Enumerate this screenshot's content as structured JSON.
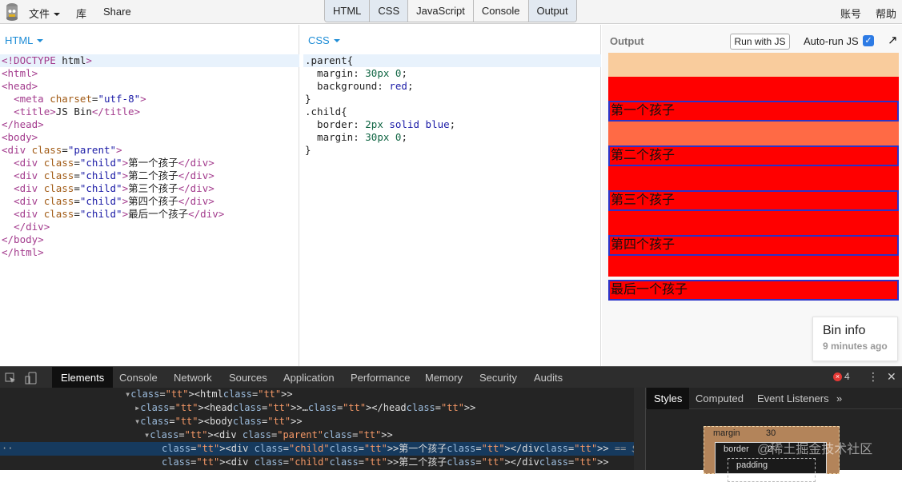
{
  "topbar": {
    "menu_file": "文件",
    "menu_library": "库",
    "menu_share": "Share",
    "tabs": [
      "HTML",
      "CSS",
      "JavaScript",
      "Console",
      "Output"
    ],
    "menu_account": "账号",
    "menu_help": "帮助"
  },
  "html_panel": {
    "title": "HTML",
    "lines": [
      "<!DOCTYPE html>",
      "<html>",
      "<head>",
      "  <meta charset=\"utf-8\">",
      "  <title>JS Bin</title>",
      "</head>",
      "<body>",
      "<div class=\"parent\">",
      "  <div class=\"child\">第一个孩子</div>",
      "  <div class=\"child\">第二个孩子</div>",
      "  <div class=\"child\">第三个孩子</div>",
      "  <div class=\"child\">第四个孩子</div>",
      "  <div class=\"child\">最后一个孩子</div>",
      "  </div>",
      "</body>",
      "</html>"
    ]
  },
  "css_panel": {
    "title": "CSS",
    "lines": [
      ".parent{",
      "  margin: 30px 0;",
      "  background: red;",
      "}",
      ".child{",
      "  border: 2px solid blue;",
      "  margin: 30px 0;",
      "}"
    ]
  },
  "output_panel": {
    "title": "Output",
    "run_button": "Run with JS",
    "autorun_label": "Auto-run JS",
    "autorun_checked": true,
    "children": [
      "第一个孩子",
      "第二个孩子",
      "第三个孩子",
      "第四个孩子",
      "最后一个孩子"
    ],
    "colors": {
      "margin_overlay": "#f9cc9d",
      "margin_highlight": "#ff6a45",
      "parent_bg": "#ff0000",
      "child_border": "#2b33c8"
    },
    "bin_info_title": "Bin info",
    "bin_info_time": "9 minutes ago"
  },
  "devtools": {
    "tabs": [
      "Elements",
      "Console",
      "Network",
      "Sources",
      "Application",
      "Performance",
      "Memory",
      "Security",
      "Audits"
    ],
    "error_count": "4",
    "tree": [
      {
        "tag": "html",
        "text": "<html>"
      },
      {
        "tag": "head",
        "text": "<head>…</head>"
      },
      {
        "tag": "body",
        "text": "<body>"
      },
      {
        "tag": "div",
        "text": "<div class=\"parent\">"
      },
      {
        "tag": "div",
        "text": "<div class=\"child\">第一个孩子</div> == $0"
      },
      {
        "tag": "div",
        "text": "<div class=\"child\">第二个孩子</div>"
      }
    ],
    "side_tabs": [
      "Styles",
      "Computed",
      "Event Listeners"
    ],
    "box_model": {
      "margin_label": "margin",
      "margin_value": "30",
      "border_label": "border",
      "border_value": "2",
      "padding_label": "padding"
    }
  },
  "watermark": "@稀土掘金技术社区"
}
